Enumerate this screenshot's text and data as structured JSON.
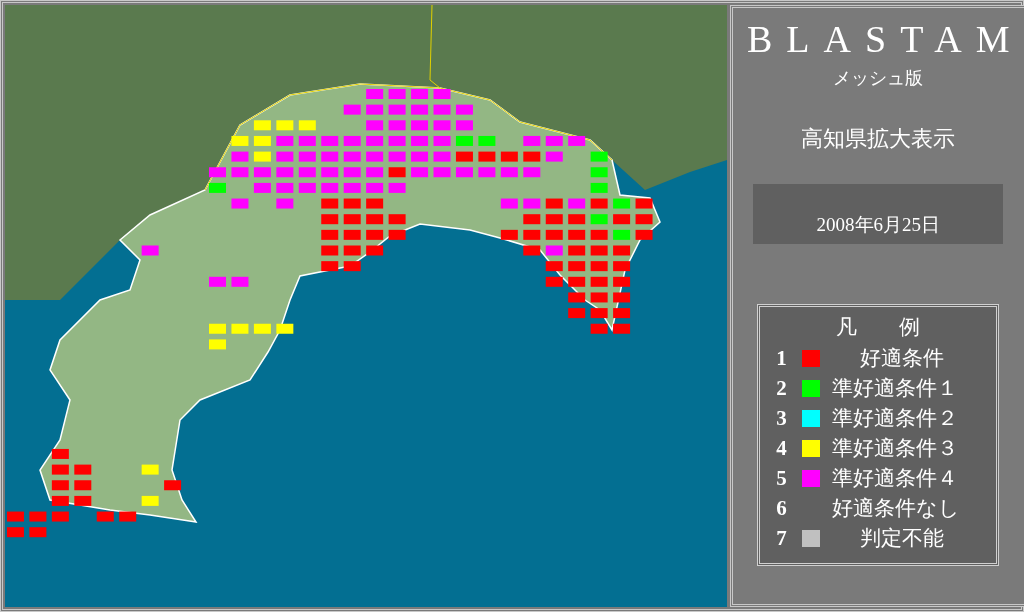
{
  "panel": {
    "title": "BLASTAM",
    "subtitle": "メッシュ版",
    "view": "高知県拡大表示",
    "date": "2008年6月25日"
  },
  "legend": {
    "title": "凡　　例",
    "items": [
      {
        "number": "1",
        "label": "好適条件",
        "color": "#ff0000"
      },
      {
        "number": "2",
        "label": "準好適条件１",
        "color": "#00ff00"
      },
      {
        "number": "3",
        "label": "準好適条件２",
        "color": "#00ffff"
      },
      {
        "number": "4",
        "label": "準好適条件３",
        "color": "#ffff00"
      },
      {
        "number": "5",
        "label": "準好適条件４",
        "color": "#ff00ff"
      },
      {
        "number": "6",
        "label": "好適条件なし"
      },
      {
        "number": "7",
        "label": "判定不能",
        "color": "#c0c0c0"
      }
    ]
  }
}
